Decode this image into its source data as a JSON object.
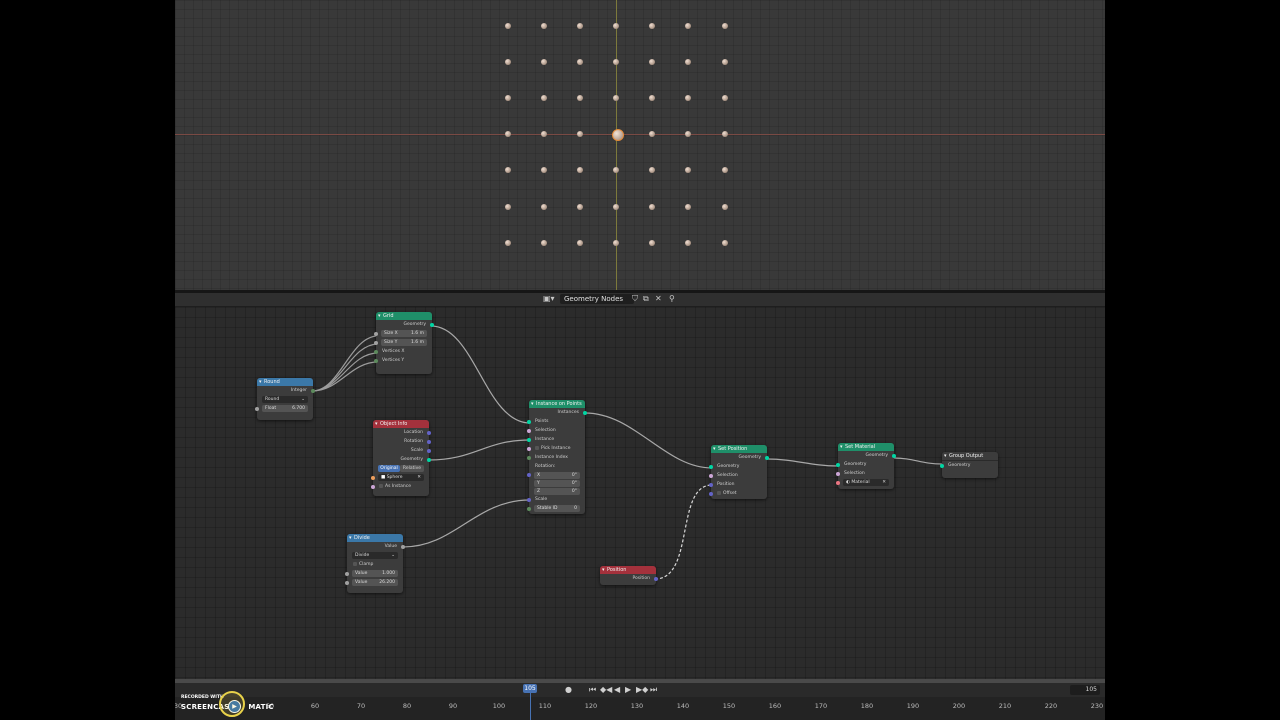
{
  "editor": {
    "tree_name": "Geometry Nodes"
  },
  "nodes": {
    "grid": {
      "title": "Grid",
      "out_geometry": "Geometry",
      "size_x_label": "Size X",
      "size_x_value": "1.6 m",
      "size_y_label": "Size Y",
      "size_y_value": "1.6 m",
      "verts_x": "Vertices X",
      "verts_y": "Vertices Y"
    },
    "round": {
      "title": "Round",
      "out_integer": "Integer",
      "mode": "Round",
      "float_label": "Float",
      "float_value": "6.700"
    },
    "object_info": {
      "title": "Object Info",
      "location": "Location",
      "rotation": "Rotation",
      "scale": "Scale",
      "geometry": "Geometry",
      "toggle_original": "Original",
      "toggle_relative": "Relative",
      "object": "Sphere",
      "as_instance": "As Instance"
    },
    "instance_on_points": {
      "title": "Instance on Points",
      "out_instances": "Instances",
      "points": "Points",
      "selection": "Selection",
      "instance": "Instance",
      "pick_instance": "Pick Instance",
      "instance_index": "Instance Index",
      "rotation": "Rotation:",
      "rx_label": "X",
      "rx_value": "0°",
      "ry_label": "Y",
      "ry_value": "0°",
      "rz_label": "Z",
      "rz_value": "0°",
      "scale": "Scale",
      "stable_id_label": "Stable ID",
      "stable_id_value": "0"
    },
    "divide": {
      "title": "Divide",
      "out_value": "Value",
      "op": "Divide",
      "clamp": "Clamp",
      "value1_label": "Value",
      "value1": "1.000",
      "value2_label": "Value",
      "value2": "26.200"
    },
    "set_position": {
      "title": "Set Position",
      "out_geometry": "Geometry",
      "geometry": "Geometry",
      "selection": "Selection",
      "position": "Position",
      "offset": "Offset"
    },
    "position": {
      "title": "Position",
      "out_position": "Position"
    },
    "set_material": {
      "title": "Set Material",
      "out_geometry": "Geometry",
      "geometry": "Geometry",
      "selection": "Selection",
      "material": "Material"
    },
    "group_output": {
      "title": "Group Output",
      "geometry": "Geometry"
    }
  },
  "timeline": {
    "current_frame": "105",
    "frame_field": "105",
    "ticks": [
      "30",
      "50",
      "60",
      "70",
      "80",
      "90",
      "100",
      "110",
      "120",
      "130",
      "140",
      "150",
      "160",
      "170",
      "180",
      "190",
      "200",
      "210",
      "220",
      "230"
    ]
  },
  "watermark": {
    "line1": "RECORDED WITH",
    "line2_a": "SCREENCAST",
    "line2_b": "MATIC"
  },
  "colors": {
    "geometry_header": "#1f8f69",
    "converter_header": "#3b78a8",
    "input_header": "#a4313c",
    "geometry_socket": "#00d6a3",
    "current_frame": "#4772b3"
  }
}
